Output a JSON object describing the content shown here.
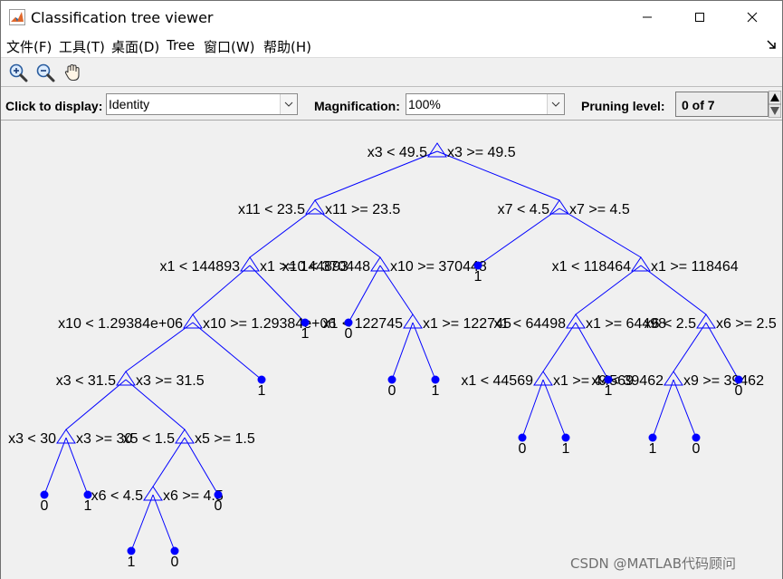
{
  "window": {
    "title": "Classification tree viewer",
    "app_icon": "matlab-icon",
    "controls": {
      "minimize": "minimize-icon",
      "maximize": "maximize-icon",
      "close": "close-icon"
    }
  },
  "menu": {
    "items": [
      "文件(F)",
      "工具(T)",
      "桌面(D)",
      "Tree",
      "窗口(W)",
      "帮助(H)"
    ],
    "dock_icon": "dock-arrow-icon"
  },
  "toolbar": {
    "tools": [
      "zoom-in-icon",
      "zoom-out-icon",
      "pan-hand-icon"
    ]
  },
  "controls": {
    "display_label": "Click to display:",
    "display_value": "Identity",
    "magnification_label": "Magnification:",
    "magnification_value": "100%",
    "pruning_label": "Pruning level:",
    "pruning_value": "0 of 7"
  },
  "tree": {
    "split_color": "#0000ff",
    "splits": [
      {
        "left": "x3 < 49.5",
        "right": "x3 >= 49.5"
      },
      {
        "left": "x11 < 23.5",
        "right": "x11 >= 23.5"
      },
      {
        "left": "x7 < 4.5",
        "right": "x7 >= 4.5"
      },
      {
        "left": "x1 < 144893",
        "right": "x1 >= 144893"
      },
      {
        "left": "x10 < 370448",
        "right": "x10 >= 370448"
      },
      {
        "left": "x1 < 118464",
        "right": "x1 >= 118464"
      },
      {
        "left": "x10 < 1.29384e+06",
        "right": "x10 >= 1.29384e+06"
      },
      {
        "left": "x1 < 122745",
        "right": "x1 >= 122745"
      },
      {
        "left": "x1 < 64498",
        "right": "x1 >= 64498"
      },
      {
        "left": "x6 < 2.5",
        "right": "x6 >= 2.5"
      },
      {
        "left": "x3 < 31.5",
        "right": "x3 >= 31.5"
      },
      {
        "left": "x1 < 44569",
        "right": "x1 >= 44569"
      },
      {
        "left": "x9 < 39462",
        "right": "x9 >= 39462"
      },
      {
        "left": "x3 < 30",
        "right": "x3 >= 30"
      },
      {
        "left": "x5 < 1.5",
        "right": "x5 >= 1.5"
      },
      {
        "left": "x6 < 4.5",
        "right": "x6 >= 4.5"
      }
    ],
    "leaves": [
      "1",
      "1",
      "0",
      "1",
      "0",
      "1",
      "1",
      "0",
      "0",
      "1",
      "0",
      "0",
      "1",
      "1",
      "0",
      "1",
      "0"
    ]
  },
  "watermark": "CSDN @MATLAB代码顾问"
}
